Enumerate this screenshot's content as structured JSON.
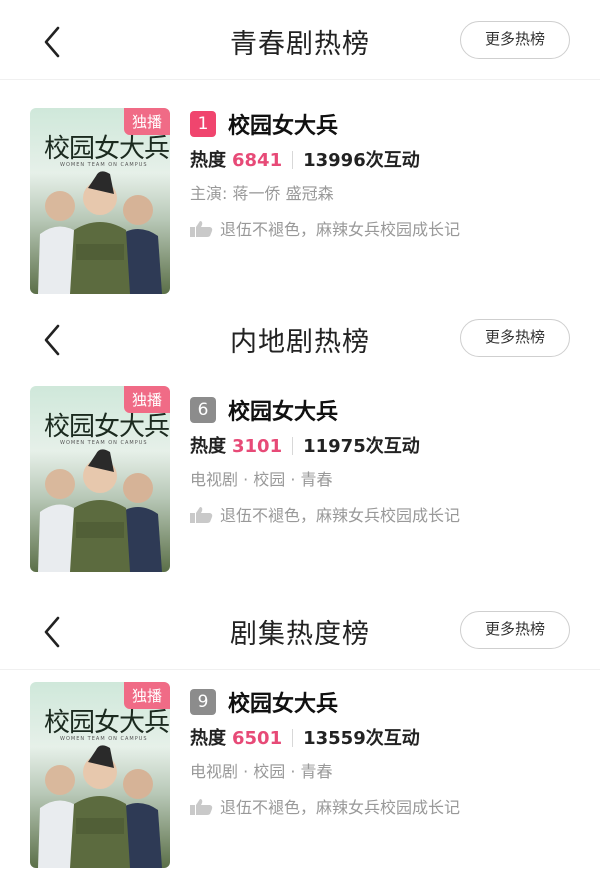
{
  "sections": [
    {
      "title": "青春剧热榜",
      "more_label": "更多热榜",
      "show": {
        "badge": "独播",
        "poster_title": "校园女大兵",
        "poster_sub": "WOMEN TEAM ON CAMPUS",
        "rank": "1",
        "rank_color": "#f0456e",
        "name": "校园女大兵",
        "hot_label": "热度",
        "hot_value": "6841",
        "interactions": "13996次互动",
        "meta": "主演: 蒋一侨 盛冠森",
        "tagline": "退伍不褪色，麻辣女兵校园成长记"
      }
    },
    {
      "title": "内地剧热榜",
      "more_label": "更多热榜",
      "show": {
        "badge": "独播",
        "poster_title": "校园女大兵",
        "poster_sub": "WOMEN TEAM ON CAMPUS",
        "rank": "6",
        "rank_color": "#8c8c8c",
        "name": "校园女大兵",
        "hot_label": "热度",
        "hot_value": "3101",
        "interactions": "11975次互动",
        "meta": "电视剧 · 校园 · 青春",
        "tagline": "退伍不褪色，麻辣女兵校园成长记"
      }
    },
    {
      "title": "剧集热度榜",
      "more_label": "更多热榜",
      "show": {
        "badge": "独播",
        "poster_title": "校园女大兵",
        "poster_sub": "WOMEN TEAM ON CAMPUS",
        "rank": "9",
        "rank_color": "#8c8c8c",
        "name": "校园女大兵",
        "hot_label": "热度",
        "hot_value": "6501",
        "interactions": "13559次互动",
        "meta": "电视剧 · 校园 · 青春",
        "tagline": "退伍不褪色，麻辣女兵校园成长记"
      }
    }
  ]
}
